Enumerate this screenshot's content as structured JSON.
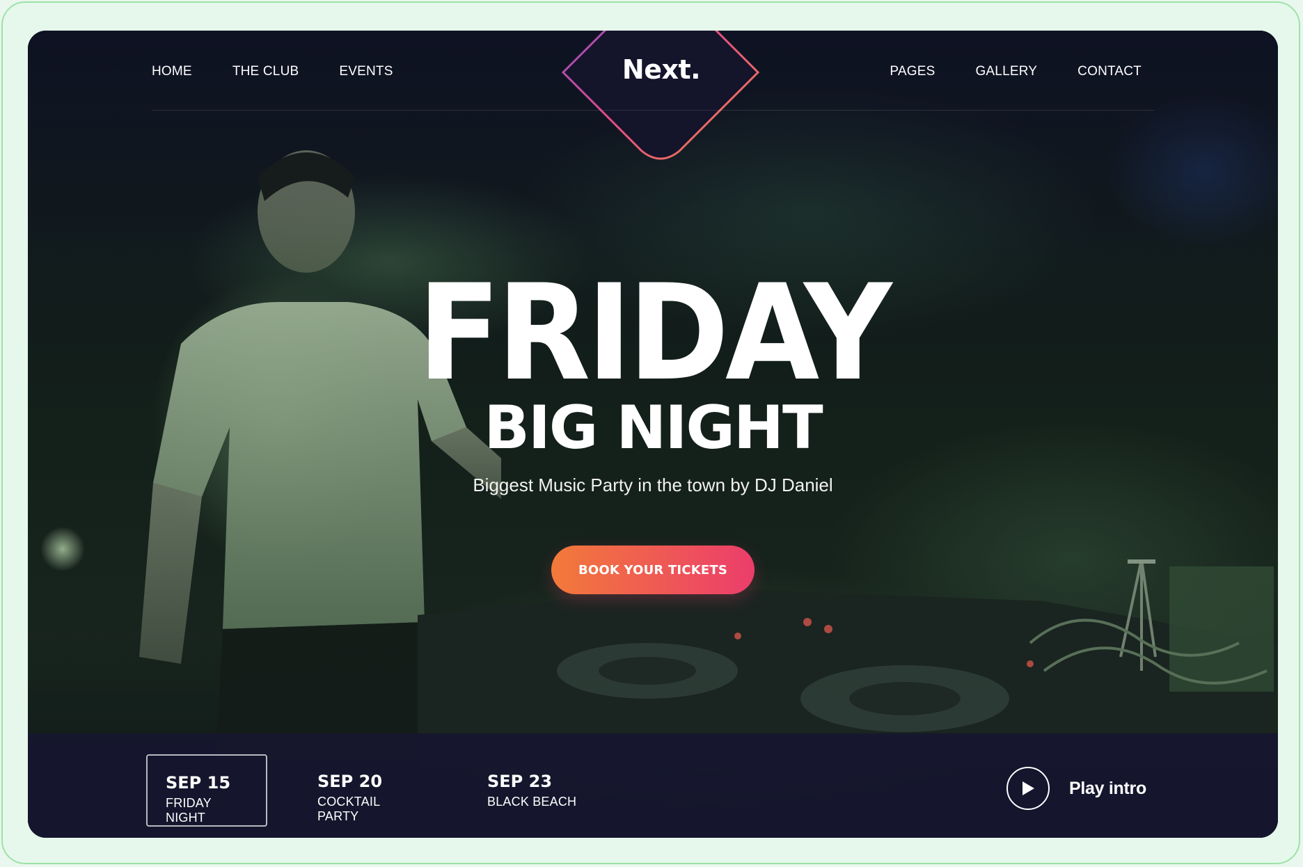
{
  "nav": {
    "left": [
      "HOME",
      "THE CLUB",
      "EVENTS"
    ],
    "right": [
      "PAGES",
      "GALLERY",
      "CONTACT"
    ],
    "logo": "Next."
  },
  "hero": {
    "title": "FRIDAY",
    "subtitle": "BIG NIGHT",
    "tagline": "Biggest Music Party in the town by DJ Daniel",
    "cta": "BOOK YOUR TICKETS"
  },
  "events": [
    {
      "date": "SEP 15",
      "name": "FRIDAY NIGHT",
      "active": true
    },
    {
      "date": "SEP 20",
      "name": "COCKTAIL PARTY",
      "active": false
    },
    {
      "date": "SEP 23",
      "name": "BLACK BEACH",
      "active": false
    }
  ],
  "play": {
    "label": "Play intro",
    "icon": "play-icon"
  },
  "colors": {
    "background": "#12142a",
    "accent_start": "#f27a3a",
    "accent_end": "#ec3d6b",
    "frame": "#9be3a6"
  }
}
